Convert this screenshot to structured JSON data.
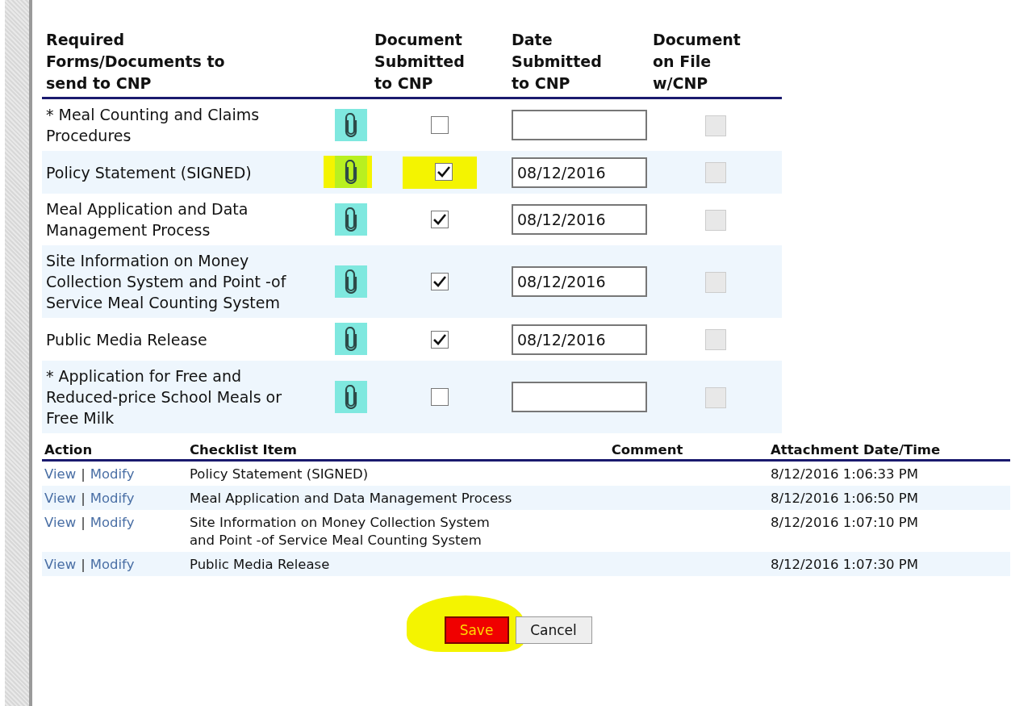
{
  "documents": {
    "columns": [
      "Required Forms/Documents to send to CNP",
      "Document Submitted to CNP",
      "Date Submitted to CNP",
      "Document on File w/CNP"
    ],
    "rows": [
      {
        "name": "* Meal Counting and Claims Procedures",
        "submitted": false,
        "date": "",
        "on_file": false,
        "on_file_disabled": true,
        "highlighted": false
      },
      {
        "name": "Policy Statement (SIGNED)",
        "submitted": true,
        "date": "08/12/2016",
        "on_file": false,
        "on_file_disabled": true,
        "highlighted": true
      },
      {
        "name": "Meal Application and Data Management Process",
        "submitted": true,
        "date": "08/12/2016",
        "on_file": false,
        "on_file_disabled": true,
        "highlighted": false
      },
      {
        "name": "Site Information on Money Collection System and Point -of Service Meal Counting System",
        "submitted": true,
        "date": "08/12/2016",
        "on_file": false,
        "on_file_disabled": true,
        "highlighted": false
      },
      {
        "name": "Public Media Release",
        "submitted": true,
        "date": "08/12/2016",
        "on_file": false,
        "on_file_disabled": true,
        "highlighted": false
      },
      {
        "name": "* Application for Free and Reduced-price School Meals or Free Milk",
        "submitted": false,
        "date": "",
        "on_file": false,
        "on_file_disabled": true,
        "highlighted": false
      }
    ]
  },
  "attachments": {
    "columns": [
      "Action",
      "Checklist Item",
      "Comment",
      "Attachment Date/Time"
    ],
    "rows": [
      {
        "view": "View",
        "separator": "|",
        "modify": "Modify",
        "item": "Policy Statement (SIGNED)",
        "datetime": "8/12/2016 1:06:33 PM"
      },
      {
        "view": "View",
        "separator": "|",
        "modify": "Modify",
        "item": "Meal Application and Data Management Process",
        "datetime": "8/12/2016 1:06:50 PM"
      },
      {
        "view": "View",
        "separator": "|",
        "modify": "Modify",
        "item": "Site Information on Money Collection System and Point -of Service Meal Counting System",
        "datetime": "8/12/2016 1:07:10 PM"
      },
      {
        "view": "View",
        "separator": "|",
        "modify": "Modify",
        "item": "Public Media Release",
        "datetime": "8/12/2016 1:07:30 PM"
      }
    ]
  },
  "buttons": {
    "save": {
      "label": "Save",
      "highlighted": true
    },
    "cancel": {
      "label": "Cancel"
    }
  }
}
